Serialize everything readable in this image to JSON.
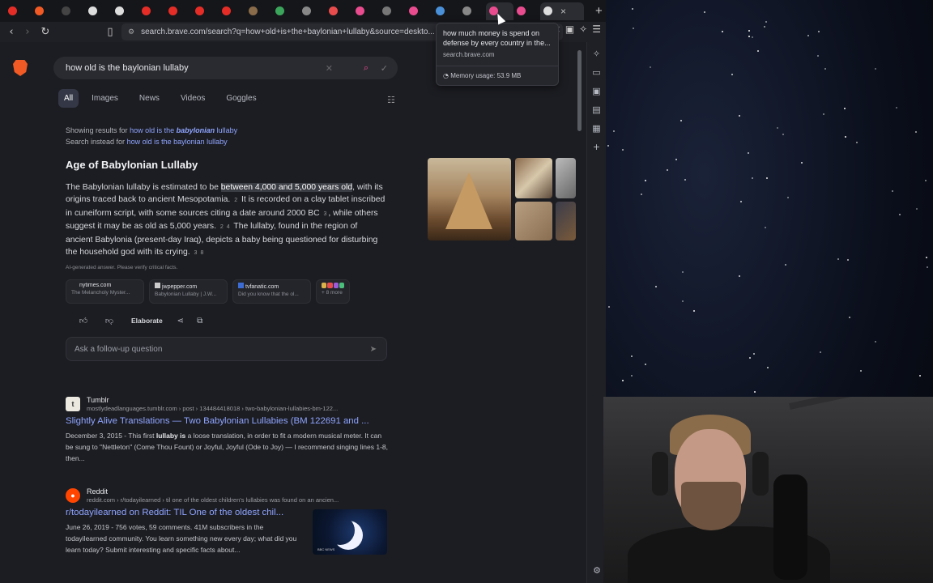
{
  "browser": {
    "url": "search.brave.com/search?q=how+old+is+the+baylonian+lullaby&source=deskto...",
    "tabs": [
      {
        "icon": "youtube-icon",
        "color": "#e52d27"
      },
      {
        "icon": "brave-icon",
        "color": "#f15a24"
      },
      {
        "icon": "github-icon",
        "color": "#444"
      },
      {
        "icon": "wikipedia-icon",
        "color": "#ddd"
      },
      {
        "icon": "wikipedia-icon",
        "color": "#ddd"
      },
      {
        "icon": "youtube-icon",
        "color": "#e52d27"
      },
      {
        "icon": "youtube-icon",
        "color": "#e52d27"
      },
      {
        "icon": "youtube-icon",
        "color": "#e52d27"
      },
      {
        "icon": "youtube-icon",
        "color": "#e52d27"
      },
      {
        "icon": "generic-icon",
        "color": "#8a6b4a"
      },
      {
        "icon": "maps-icon",
        "color": "#3ca55c"
      },
      {
        "icon": "openai-icon",
        "color": "#888"
      },
      {
        "icon": "brave-icon",
        "color": "#e94c4c"
      },
      {
        "icon": "brave-search-icon",
        "color": "#e94c8f"
      },
      {
        "icon": "image-icon",
        "color": "#777"
      },
      {
        "icon": "brave-search-icon",
        "color": "#e94c8f"
      },
      {
        "icon": "chrome-icon",
        "color": "#4a90d9"
      },
      {
        "icon": "generic-icon",
        "color": "#888"
      },
      {
        "icon": "brave-search-icon",
        "color": "#e94c8f"
      },
      {
        "icon": "brave-search-icon",
        "color": "#e94c8f"
      },
      {
        "icon": "wikipedia-icon",
        "color": "#ddd"
      }
    ]
  },
  "hover_card": {
    "title": "how much money is spend on defense by every country in the...",
    "site": "search.brave.com",
    "memory": "Memory usage: 53.9 MB"
  },
  "search": {
    "query": "how old is the baylonian lullaby"
  },
  "filters": [
    "All",
    "Images",
    "News",
    "Videos",
    "Goggles"
  ],
  "correction": {
    "showing_prefix": "Showing results for",
    "showing_link_a": "how old is the",
    "showing_link_em": "babylonian",
    "showing_link_b": "lullaby",
    "instead_prefix": "Search instead for",
    "instead_link": "how old is the baylonian lullaby"
  },
  "ai_answer": {
    "title": "Age of Babylonian Lullaby",
    "p1": "The Babylonian lullaby is estimated to be",
    "highlight": "between 4,000 and 5,000 years old",
    "p2": ", with its origins traced back to ancient Mesopotamia.",
    "c1": "2",
    "p3": "It is recorded on a clay tablet inscribed in cuneiform script, with some sources citing a date around 2000 BC",
    "c2": "3",
    "p4": ", while others suggest it may be as old as 5,000 years.",
    "c3": "2",
    "c4": "4",
    "p5": "The lullaby, found in the region of ancient Babylonia (present-day Iraq), depicts a baby being questioned for disturbing the household god with its crying.",
    "c5": "3",
    "c6": "8",
    "note": "AI-generated answer. Please verify critical facts.",
    "sources": [
      {
        "site": "nytimes.com",
        "sub": "The Melancholy Myster..."
      },
      {
        "site": "jwpepper.com",
        "sub": "Babylonian Lullaby | J.W..."
      },
      {
        "site": "tvfanatic.com",
        "sub": "Did you know that the ol..."
      }
    ],
    "more": "+ 8 more",
    "elaborate": "Elaborate",
    "followup_placeholder": "Ask a follow-up question"
  },
  "results": [
    {
      "site": "Tumblr",
      "url": "mostlydeadlanguages.tumblr.com › post › 134484418018 › two-babylonian-lullabies-bm-122...",
      "title": "Slightly Alive Translations — Two Babylonian Lullabies (BM 122691 and ...",
      "snippet_a": "December 3, 2015 - This first",
      "snippet_b": "lullaby is",
      "snippet_c": "a loose translation, in order to fit a modern musical meter. It can be sung to \"Nettleton\" (Come Thou Fount) or Joyful, Joyful (Ode to Joy) — I recommend singing lines 1-8, then..."
    },
    {
      "site": "Reddit",
      "url": "reddit.com › r/todayilearned › til one of the oldest children's lullabies was found on an ancien...",
      "title": "r/todayilearned on Reddit: TIL One of the oldest chil...",
      "snippet": "June 26, 2019 - 756 votes, 59 comments. 41M subscribers in the todayilearned community. You learn something new every day; what did you learn today? Submit interesting and specific facts about...",
      "thumb_tag": "BBC NEWS"
    }
  ]
}
